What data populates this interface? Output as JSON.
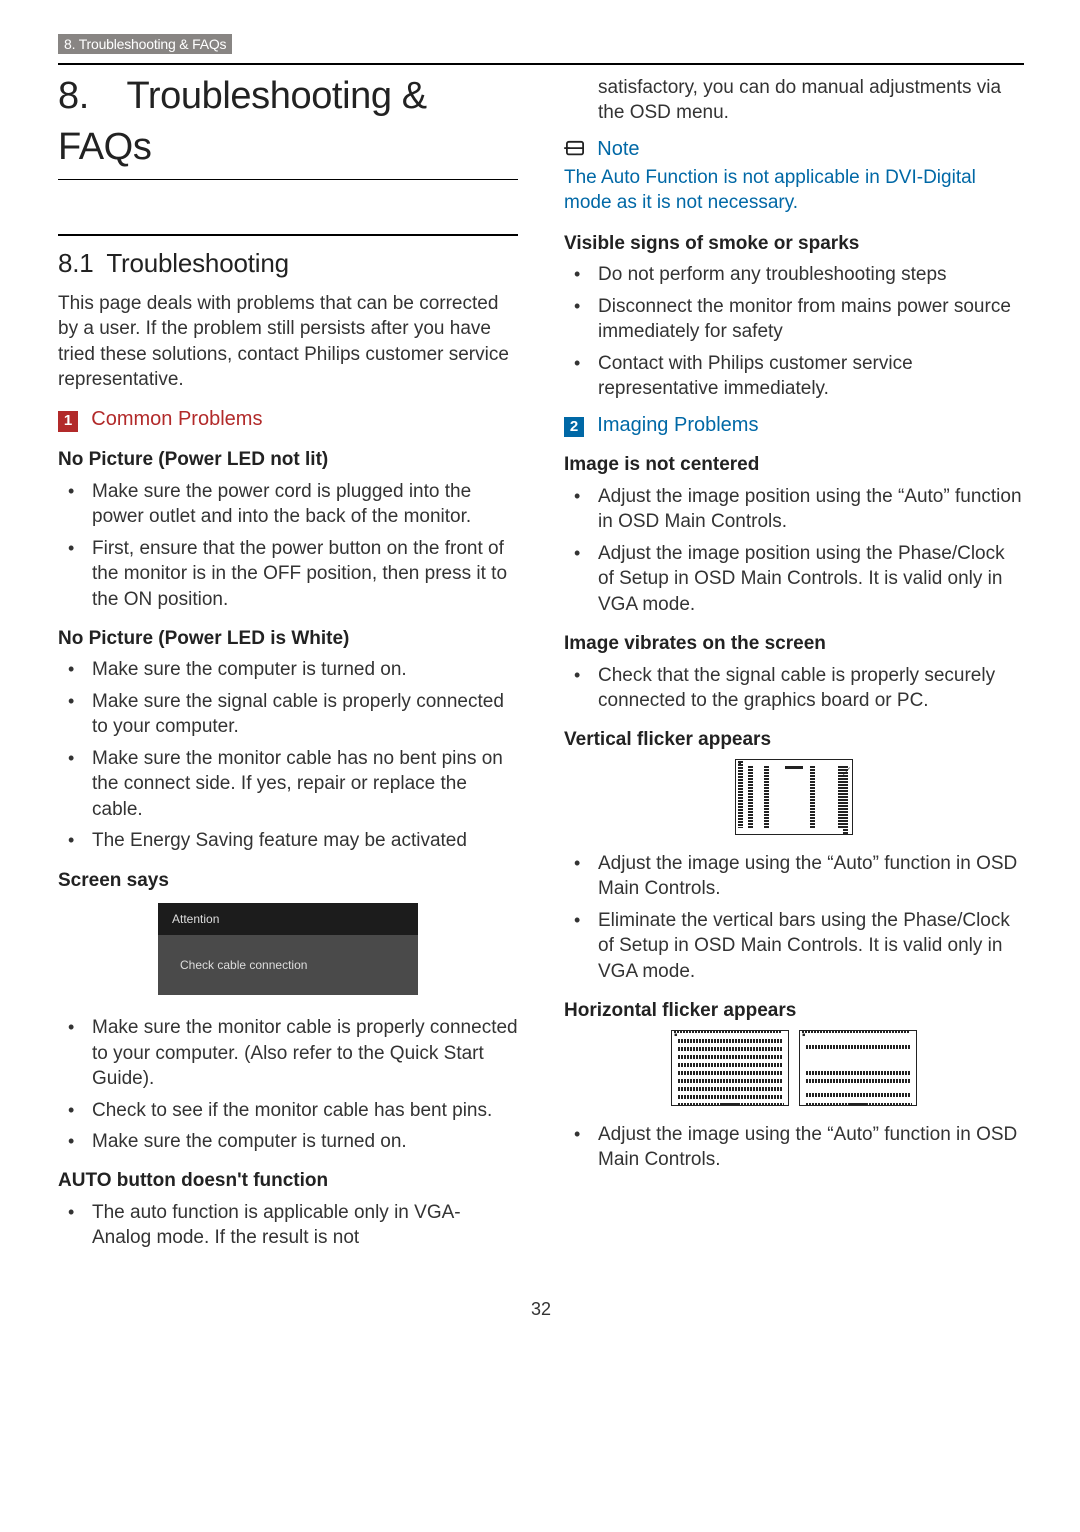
{
  "topbar": "8. Troubleshooting & FAQs",
  "h1": "8. Troubleshooting & FAQs",
  "h2": "8.1 Troubleshooting",
  "intro": "This page deals with problems that can be corrected by a user. If the problem still persists after you have tried these solutions, contact Philips customer service representative.",
  "sec1": {
    "num": "1",
    "title": "Common Problems"
  },
  "sub_no_pic_led_off": "No Picture (Power LED not lit)",
  "li_no_pic_off": [
    "Make sure the power cord is plugged into the power outlet and into the back of the monitor.",
    "First, ensure that the power button on the front of the monitor is in the OFF position, then press it to the ON position."
  ],
  "sub_no_pic_led_white": "No Picture (Power LED is White)",
  "li_no_pic_white": [
    "Make sure the computer is turned on.",
    "Make sure the signal cable is properly connected to your computer.",
    "Make sure the monitor cable has no bent pins on the connect side. If yes, repair or replace the cable.",
    "The Energy Saving feature may be activated"
  ],
  "sub_screen_says": "Screen says",
  "msg_hdr": "Attention",
  "msg_body": "Check cable connection",
  "li_screen_says": [
    "Make sure the monitor cable is properly connected to your computer. (Also refer to the Quick Start Guide).",
    "Check to see if the monitor cable has bent pins.",
    "Make sure the computer is turned on."
  ],
  "sub_auto": "AUTO button doesn't function",
  "li_auto": [
    "The auto function is applicable only in VGA-Analog mode.  If the result is not"
  ],
  "right_lead": "satisfactory, you can do manual adjustments via the OSD menu.",
  "note_label": "Note",
  "note_text": "The Auto Function is not applicable in DVI-Digital mode as it is not necessary.",
  "sub_smoke": "Visible signs of smoke or sparks",
  "li_smoke": [
    "Do not perform any troubleshooting steps",
    "Disconnect the monitor from mains power source immediately for safety",
    "Contact with Philips customer service representative immediately."
  ],
  "sec2": {
    "num": "2",
    "title": "Imaging Problems"
  },
  "sub_centered": "Image is not centered",
  "li_centered": [
    "Adjust the image position using the “Auto” function in OSD Main Controls.",
    "Adjust the image position using the Phase/Clock of Setup in OSD Main Controls.  It is valid only in VGA mode."
  ],
  "sub_vibrates": "Image vibrates on the screen",
  "li_vibrates": [
    "Check that the signal cable is properly securely connected to the graphics board or PC."
  ],
  "sub_vflicker": "Vertical flicker appears",
  "li_vflicker": [
    "Adjust the image using the “Auto” function in OSD Main Controls.",
    "Eliminate the vertical bars using the Phase/Clock of Setup in OSD Main Controls. It is valid only in VGA mode."
  ],
  "sub_hflicker": "Horizontal flicker appears",
  "li_hflicker": [
    "Adjust the image using the “Auto” function in OSD Main Controls."
  ],
  "pagenum": "32"
}
